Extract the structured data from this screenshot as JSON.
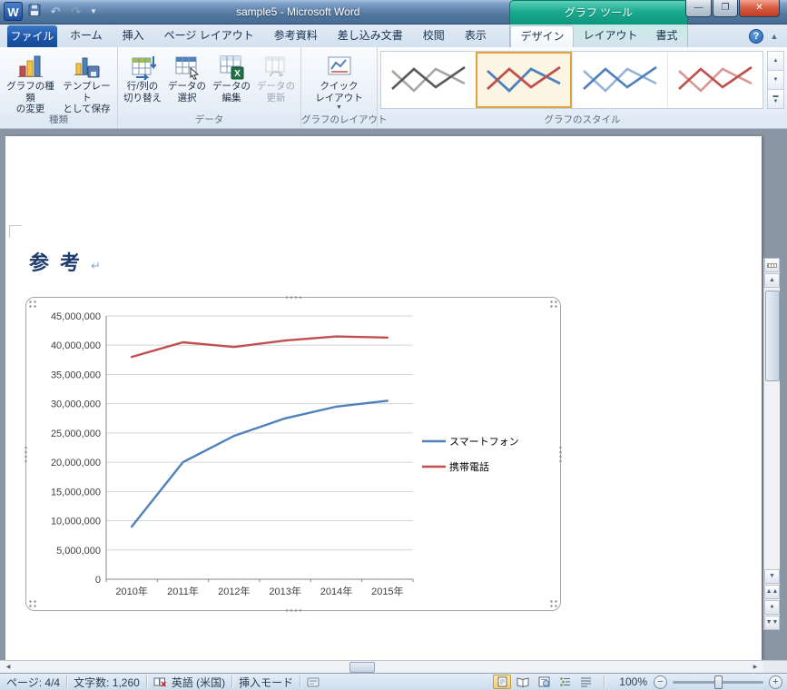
{
  "window": {
    "title": "sample5 - Microsoft Word",
    "contextual_header": "グラフ ツール"
  },
  "ribbon": {
    "file_tab": "ファイル",
    "tabs": [
      "ホーム",
      "挿入",
      "ページ レイアウト",
      "参考資料",
      "差し込み文書",
      "校閲",
      "表示"
    ],
    "contextual_tabs": [
      "デザイン",
      "レイアウト",
      "書式"
    ],
    "groups": {
      "type": {
        "label": "種類",
        "change_chart_type": "グラフの種類\nの変更",
        "save_as_template": "テンプレート\nとして保存"
      },
      "data": {
        "label": "データ",
        "switch_row_column": "行/列の\n切り替え",
        "select_data": "データの\n選択",
        "edit_data": "データの\n編集",
        "refresh_data": "データの\n更新"
      },
      "chart_layouts": {
        "label": "グラフのレイアウト",
        "quick_layout": "クイック\nレイアウト"
      },
      "chart_styles": {
        "label": "グラフのスタイル"
      }
    }
  },
  "document": {
    "heading": "参考",
    "paragraph_mark": "↵"
  },
  "chart_data": {
    "type": "line",
    "title": "",
    "xlabel": "",
    "ylabel": "",
    "categories": [
      "2010年",
      "2011年",
      "2012年",
      "2013年",
      "2014年",
      "2015年"
    ],
    "series": [
      {
        "name": "スマートフォン",
        "color": "#4F81BD",
        "values": [
          9000000,
          20000000,
          24500000,
          27500000,
          29500000,
          30500000
        ]
      },
      {
        "name": "携帯電話",
        "color": "#C0504D",
        "values": [
          38000000,
          40500000,
          39700000,
          40800000,
          41500000,
          41300000
        ]
      }
    ],
    "ylim": [
      0,
      45000000
    ],
    "ytick_step": 5000000,
    "grid": true,
    "legend_position": "right"
  },
  "status_bar": {
    "page": "ページ: 4/4",
    "word_count": "文字数: 1,260",
    "language": "英語 (米国)",
    "input_mode": "挿入モード",
    "zoom": "100%"
  }
}
